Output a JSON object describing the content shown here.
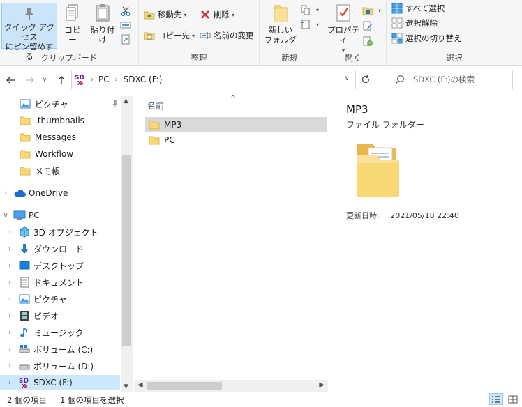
{
  "ribbon": {
    "clipboard": {
      "pin_line1": "クイック アクセス",
      "pin_line2": "にピン留めする",
      "copy": "コピー",
      "paste": "貼り付け",
      "label": "クリップボード"
    },
    "organize": {
      "move_to": "移動先",
      "copy_to": "コピー先",
      "delete": "削除",
      "rename": "名前の変更",
      "label": "整理"
    },
    "new": {
      "folder_line1": "新しい",
      "folder_line2": "フォルダー",
      "label": "新規"
    },
    "open": {
      "properties": "プロパティ",
      "label": "開く"
    },
    "select": {
      "select_all": "すべて選択",
      "select_none": "選択解除",
      "invert": "選択の切り替え",
      "label": "選択"
    }
  },
  "address": {
    "path": [
      "PC",
      "SDXC (F:)"
    ],
    "search_placeholder": "SDXC (F:)の検索"
  },
  "nav": {
    "quick": [
      "ピクチャ",
      ".thumbnails",
      "Messages",
      "Workflow",
      "メモ帳"
    ],
    "onedrive": "OneDrive",
    "pc": "PC",
    "pc_children": [
      "3D オブジェクト",
      "ダウンロード",
      "デスクトップ",
      "ドキュメント",
      "ピクチャ",
      "ビデオ",
      "ミュージック",
      "ボリューム (C:)",
      "ボリューム (D:)",
      "SDXC (F:)"
    ]
  },
  "content": {
    "column_header": "名前",
    "items": [
      "MP3",
      "PC"
    ]
  },
  "preview": {
    "name": "MP3",
    "type": "ファイル フォルダー",
    "modified_label": "更新日時:",
    "modified_value": "2021/05/18 22:40"
  },
  "status": {
    "count": "2 個の項目",
    "selected": "1 個の項目を選択"
  },
  "colors": {
    "selection": "#cce8ff",
    "folder": "#f8d775",
    "accent": "#1979ca"
  }
}
